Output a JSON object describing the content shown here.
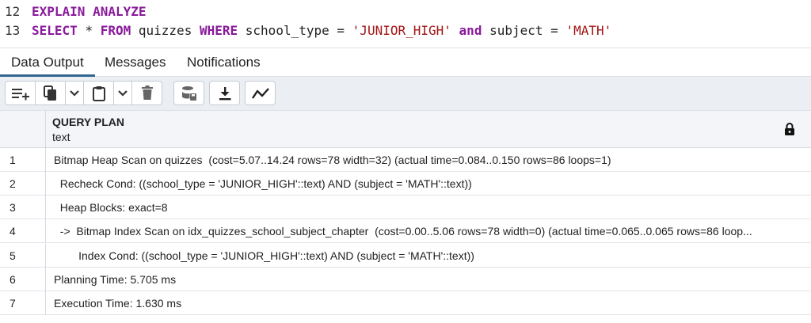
{
  "editor": {
    "lines": [
      {
        "number": "12",
        "tokens": [
          "EXPLAIN",
          "ANALYZE"
        ]
      },
      {
        "number": "13",
        "tokens": [
          "SELECT",
          "*",
          "FROM",
          "quizzes",
          "WHERE",
          "school_type",
          "=",
          "'JUNIOR_HIGH'",
          "and",
          "subject",
          "=",
          "'MATH'"
        ]
      }
    ],
    "colors": {
      "keyword": "#8a1a9c",
      "string": "#a31515",
      "identifier": "#222222"
    }
  },
  "tabs": [
    {
      "label": "Data Output",
      "active": true
    },
    {
      "label": "Messages",
      "active": false
    },
    {
      "label": "Notifications",
      "active": false
    }
  ],
  "toolbar": {
    "buttons": [
      "add-row-icon",
      "copy-icon",
      "chevron-down-icon",
      "paste-icon",
      "chevron-down-icon",
      "delete-icon",
      "save-data-icon",
      "download-icon",
      "graph-icon"
    ]
  },
  "grid": {
    "column": {
      "name": "QUERY PLAN",
      "type": "text"
    },
    "rows": [
      {
        "num": "1",
        "text": "Bitmap Heap Scan on quizzes  (cost=5.07..14.24 rows=78 width=32) (actual time=0.084..0.150 rows=86 loops=1)"
      },
      {
        "num": "2",
        "text": "  Recheck Cond: ((school_type = 'JUNIOR_HIGH'::text) AND (subject = 'MATH'::text))"
      },
      {
        "num": "3",
        "text": "  Heap Blocks: exact=8"
      },
      {
        "num": "4",
        "text": "  ->  Bitmap Index Scan on idx_quizzes_school_subject_chapter  (cost=0.00..5.06 rows=78 width=0) (actual time=0.065..0.065 rows=86 loop..."
      },
      {
        "num": "5",
        "text": "        Index Cond: ((school_type = 'JUNIOR_HIGH'::text) AND (subject = 'MATH'::text))"
      },
      {
        "num": "6",
        "text": "Planning Time: 5.705 ms"
      },
      {
        "num": "7",
        "text": "Execution Time: 1.630 ms"
      }
    ]
  },
  "accent_color": "#326690"
}
